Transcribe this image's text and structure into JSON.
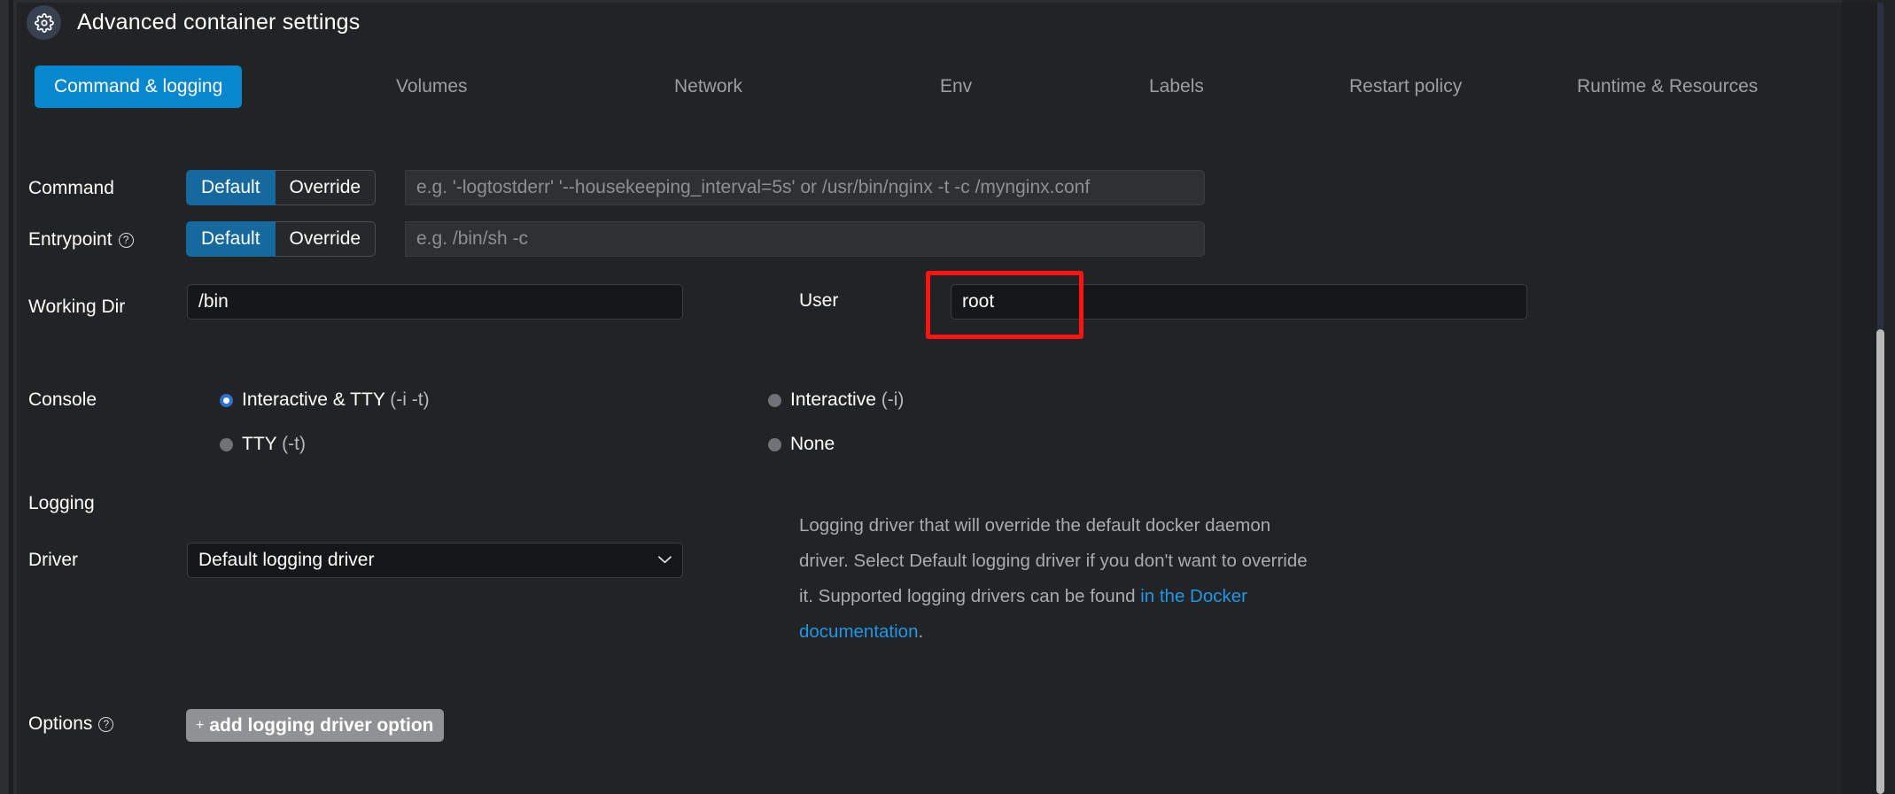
{
  "header": {
    "icon": "gear-icon",
    "title": "Advanced container settings"
  },
  "tabs": [
    {
      "label": "Command & logging",
      "active": true
    },
    {
      "label": "Volumes",
      "active": false
    },
    {
      "label": "Network",
      "active": false
    },
    {
      "label": "Env",
      "active": false
    },
    {
      "label": "Labels",
      "active": false
    },
    {
      "label": "Restart policy",
      "active": false
    },
    {
      "label": "Runtime & Resources",
      "active": false
    }
  ],
  "fields": {
    "command": {
      "label": "Command",
      "default_label": "Default",
      "override_label": "Override",
      "selected": "Default",
      "value": "",
      "placeholder": "e.g. '-logtostderr' '--housekeeping_interval=5s' or /usr/bin/nginx -t -c /mynginx.conf"
    },
    "entrypoint": {
      "label": "Entrypoint",
      "help_icon": "question-mark-icon",
      "default_label": "Default",
      "override_label": "Override",
      "selected": "Default",
      "value": "",
      "placeholder": "e.g. /bin/sh -c"
    },
    "working_dir": {
      "label": "Working Dir",
      "value": "/bin",
      "placeholder": ""
    },
    "user": {
      "label": "User",
      "value": "root",
      "placeholder": "",
      "highlight_color": "#fe1212"
    },
    "console": {
      "label": "Console",
      "options": [
        {
          "text": "Interactive & TTY ",
          "flag": "(-i -t)",
          "checked": true
        },
        {
          "text": "Interactive ",
          "flag": "(-i)",
          "checked": false
        },
        {
          "text": "TTY ",
          "flag": "(-t)",
          "checked": false
        },
        {
          "text": "None",
          "flag": "",
          "checked": false
        }
      ]
    },
    "logging": {
      "section_label": "Logging",
      "driver_label": "Driver",
      "driver_value": "Default logging driver",
      "chevron": "chevron-down-icon",
      "help_text_1": "Logging driver that will override the default docker daemon driver. Select Default logging driver if you don't want to override it. Supported logging drivers can be found ",
      "help_link": "in the Docker documentation",
      "help_text_2": "."
    },
    "options": {
      "label": "Options",
      "help_icon": "question-mark-icon",
      "add_button_plus": "+",
      "add_button_label": "add logging driver option"
    }
  },
  "colors": {
    "accent": "#0787cd",
    "segment_active": "#15699f",
    "link": "#2196e8",
    "highlight": "#fe1212",
    "background": "#222324"
  }
}
